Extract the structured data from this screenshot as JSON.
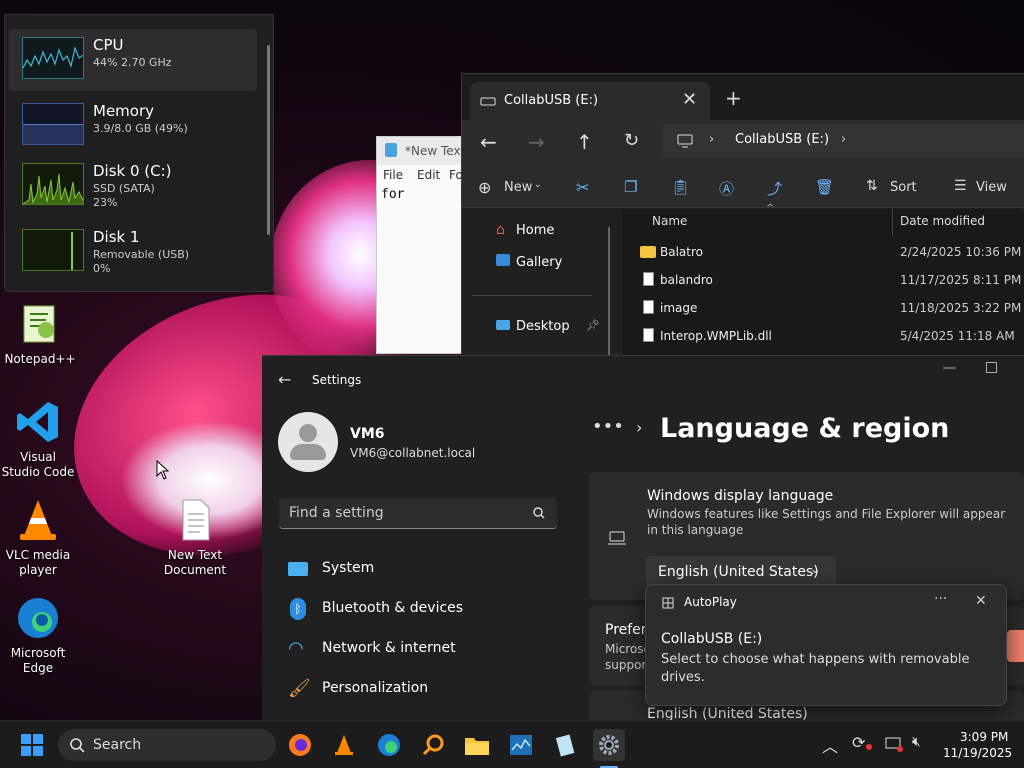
{
  "desktop": {
    "icons": [
      {
        "label": "Notepad++"
      },
      {
        "label": "Visual Studio Code"
      },
      {
        "label": "VLC media player"
      },
      {
        "label": "Microsoft Edge"
      },
      {
        "label": "New Text Document"
      }
    ]
  },
  "perf": {
    "items": [
      {
        "name": "CPU",
        "line1": "44%  2.70 GHz",
        "line2": ""
      },
      {
        "name": "Memory",
        "line1": "3.9/8.0 GB (49%)",
        "line2": ""
      },
      {
        "name": "Disk 0 (C:)",
        "line1": "SSD (SATA)",
        "line2": "23%"
      },
      {
        "name": "Disk 1",
        "line1": "Removable (USB)",
        "line2": "0%"
      }
    ],
    "memory_fill": 0.49
  },
  "notepad": {
    "tab_title": "*New Text",
    "menu": [
      "File",
      "Edit",
      "Fo"
    ],
    "content": "for"
  },
  "explorer": {
    "tab_title": "CollabUSB (E:)",
    "breadcrumb": "CollabUSB (E:)",
    "toolbar": {
      "new": "New",
      "sort": "Sort",
      "view": "View"
    },
    "sidebar": [
      "Home",
      "Gallery",
      "Desktop"
    ],
    "columns": {
      "name": "Name",
      "date": "Date modified"
    },
    "files": [
      {
        "name": "Balatro",
        "date": "2/24/2025 10:36 PM",
        "kind": "folder"
      },
      {
        "name": "balandro",
        "date": "11/17/2025 8:11 PM",
        "kind": "file"
      },
      {
        "name": "image",
        "date": "11/18/2025 3:22 PM",
        "kind": "file"
      },
      {
        "name": "Interop.WMPLib.dll",
        "date": "5/4/2025 11:18 AM",
        "kind": "file"
      }
    ]
  },
  "settings": {
    "app_title": "Settings",
    "user_name": "VM6",
    "user_email": "VM6@collabnet.local",
    "search_placeholder": "Find a setting",
    "nav": [
      "System",
      "Bluetooth & devices",
      "Network & internet",
      "Personalization"
    ],
    "page_title": "Language & region",
    "display_language_title": "Windows display language",
    "display_language_desc": "Windows features like Settings and File Explorer will appear in this language",
    "display_language_value": "English (United States)",
    "preferred_partial": "Prefer",
    "preferred_desc_1": "Microsc",
    "preferred_desc_2": "suppor",
    "lang_row": "English (United States)"
  },
  "autoplay": {
    "app": "AutoPlay",
    "title": "CollabUSB (E:)",
    "message": "Select to choose what happens with removable drives."
  },
  "taskbar": {
    "search": "Search",
    "time": "3:09 PM",
    "date": "11/19/2025"
  }
}
